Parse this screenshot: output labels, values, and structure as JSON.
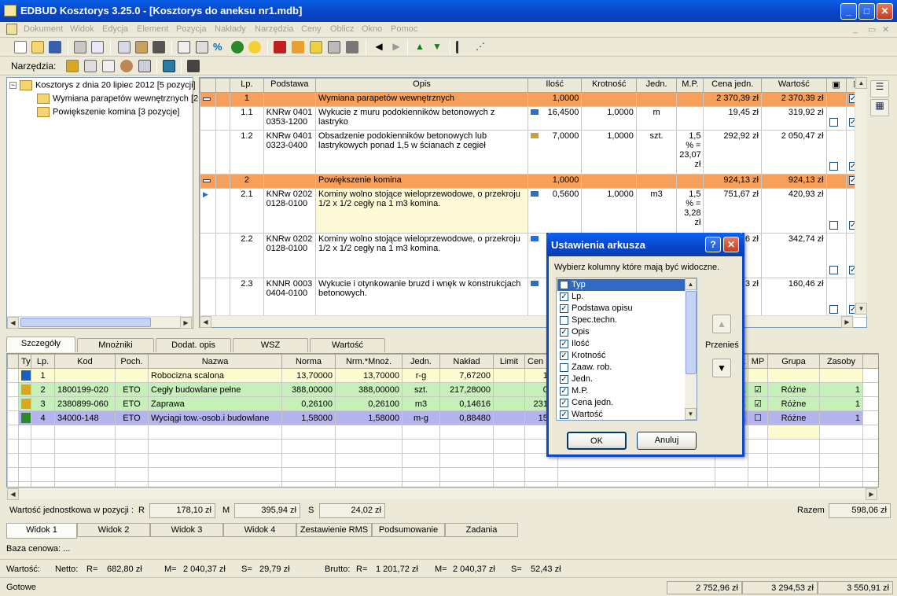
{
  "window": {
    "title": "EDBUD Kosztorys 3.25.0 - [Kosztorys do aneksu nr1.mdb]"
  },
  "menu": [
    "Dokument",
    "Widok",
    "Edycja",
    "Element",
    "Pozycja",
    "Nakłady",
    "Narzędzia",
    "Ceny",
    "Oblicz",
    "Okno",
    "Pomoc"
  ],
  "toolbar2": {
    "label": "Narzędzia:"
  },
  "tree": {
    "root": "Kosztorys z dnia 20 lipiec 2012 [5 pozycji]",
    "children": [
      "Wymiana parapetów wewnętrznych [2",
      "Powiększenie komina [3 pozycje]"
    ]
  },
  "grid": {
    "headers": [
      "Lp.",
      "Podstawa",
      "Opis",
      "Ilość",
      "Krotność",
      "Jedn.",
      "M.P.",
      "Cena jedn.",
      "Wartość"
    ],
    "rows": [
      {
        "kind": "section",
        "lp": "1",
        "podstawa": "",
        "opis": "Wymiana parapetów wewnętrznych",
        "ilosc": "1,0000",
        "krotnosc": "",
        "jedn": "",
        "mp": "",
        "cena": "2 370,39 zł",
        "wartosc": "2 370,39 zł"
      },
      {
        "kind": "item",
        "lp": "1.1",
        "podstawa": "KNRw 0401 0353-1200",
        "opis": "Wykucie z muru podokienników betonowych z lastryko",
        "ilosc": "16,4500",
        "krotnosc": "1,0000",
        "jedn": "m",
        "mp": "",
        "cena": "19,45 zł",
        "wartosc": "319,92 zł"
      },
      {
        "kind": "item",
        "lp": "1.2",
        "podstawa": "KNRw 0401 0323-0400",
        "opis": "Obsadzenie podokienników betonowych lub lastrykowych ponad 1,5 w ścianach z cegieł",
        "ilosc": "7,0000",
        "krotnosc": "1,0000",
        "jedn": "szt.",
        "mp": "1,5 % = 23,07 zł",
        "cena": "292,92 zł",
        "wartosc": "2 050,47 zł"
      },
      {
        "kind": "section",
        "lp": "2",
        "podstawa": "",
        "opis": "Powiększenie komina",
        "ilosc": "1,0000",
        "krotnosc": "",
        "jedn": "",
        "mp": "",
        "cena": "924,13 zł",
        "wartosc": "924,13 zł"
      },
      {
        "kind": "item",
        "lp": "2.1",
        "podstawa": "KNRw 0202 0128-0100",
        "opis": "Kominy wolno stojące wieloprzewodowe, o przekroju 1/2 x 1/2 cegły na 1 m3 komina.",
        "ilosc": "0,5600",
        "krotnosc": "1,0000",
        "jedn": "m3",
        "mp": "1,5 % = 3,28 zł",
        "cena": "751,67 zł",
        "wartosc": "420,93 zł"
      },
      {
        "kind": "item",
        "lp": "2.2",
        "podstawa": "KNRw 0202 0128-0100",
        "opis": "Kominy wolno stojące wieloprzewodowe, o przekroju 1/2 x 1/2 cegły na 1 m3 komina.",
        "ilosc": "",
        "krotnosc": "",
        "jedn": "",
        "mp": "",
        "cena": "6 zł",
        "wartosc": "342,74 zł"
      },
      {
        "kind": "item",
        "lp": "2.3",
        "podstawa": "KNNR 0003 0404-0100",
        "opis": "Wykucie i otynkowanie bruzd i wnęk w konstrukcjach betonowych.",
        "ilosc": "",
        "krotnosc": "",
        "jedn": "",
        "mp": "",
        "cena": "3 zł",
        "wartosc": "160,46 zł"
      }
    ]
  },
  "tabs_detail": [
    "Szczegóły",
    "Mnożniki",
    "Dodat. opis",
    "WSZ",
    "Wartość"
  ],
  "lower": {
    "headers": [
      "Typ",
      "Lp.",
      "Kod",
      "Poch.",
      "Nazwa",
      "Norma",
      "Nrm.*Mnoż.",
      "Jedn.",
      "Nakład",
      "Limit",
      "Cen",
      "nik",
      "MP",
      "Grupa",
      "Zasoby"
    ],
    "rows": [
      {
        "lp": "1",
        "kod": "",
        "poch": "",
        "nazwa": "Robocizna scalona",
        "norma": "13,70000",
        "nrm": "13,70000",
        "jedn": "r-g",
        "naklad": "7,67200",
        "limit": "",
        "cen": "13,",
        "nik": "",
        "mp": "",
        "grupa": "",
        "zasoby": ""
      },
      {
        "lp": "2",
        "kod": "1800199-020",
        "poch": "ETO",
        "nazwa": "Cegły budowlane pełne",
        "norma": "388,00000",
        "nrm": "388,00000",
        "jedn": "szt.",
        "naklad": "217,28000",
        "limit": "",
        "cen": "0,8",
        "nik": "1",
        "mp": "☑",
        "grupa": "Różne",
        "zasoby": "1"
      },
      {
        "lp": "3",
        "kod": "2380899-060",
        "poch": "ETO",
        "nazwa": "Zaprawa",
        "norma": "0,26100",
        "nrm": "0,26100",
        "jedn": "m3",
        "naklad": "0,14616",
        "limit": "",
        "cen": "231,0",
        "nik": "1",
        "mp": "☑",
        "grupa": "Różne",
        "zasoby": "1"
      },
      {
        "lp": "4",
        "kod": "34000-148",
        "poch": "ETO",
        "nazwa": "Wyciągi tow.-osob.i budowlane",
        "norma": "1,58000",
        "nrm": "1,58000",
        "jedn": "m-g",
        "naklad": "0,88480",
        "limit": "",
        "cen": "15,2",
        "nik": "1",
        "mp": "☐",
        "grupa": "Różne",
        "zasoby": "1"
      }
    ]
  },
  "summary": {
    "label": "Wartość jednostkowa w pozycji :",
    "r_label": "R",
    "r": "178,10 zł",
    "m_label": "M",
    "m": "395,94 zł",
    "s_label": "S",
    "s": "24,02 zł",
    "razem_label": "Razem",
    "razem": "598,06 zł"
  },
  "tabs_views": [
    "Widok 1",
    "Widok 2",
    "Widok 3",
    "Widok 4",
    "Zestawienie RMS",
    "Podsumowanie",
    "Zadania"
  ],
  "baza": "Baza cenowa: ...",
  "wartosc": {
    "label": "Wartość:",
    "netto": "Netto:",
    "nr": "R=",
    "nrv": "682,80 zł",
    "nm": "M=",
    "nmv": "2 040,37 zł",
    "ns": "S=",
    "nsv": "29,79 zł",
    "brutto": "Brutto:",
    "br": "R=",
    "brv": "1 201,72 zł",
    "bm": "M=",
    "bmv": "2 040,37 zł",
    "bs": "S=",
    "bsv": "52,43 zł"
  },
  "status": {
    "text": "Gotowe",
    "p1": "2 752,96 zł",
    "p2": "3 294,53 zł",
    "p3": "3 550,91 zł"
  },
  "dialog": {
    "title": "Ustawienia arkusza",
    "prompt": "Wybierz kolumny które mają być widoczne.",
    "items": [
      {
        "label": "Typ",
        "checked": false
      },
      {
        "label": "Lp.",
        "checked": true
      },
      {
        "label": "Podstawa opisu",
        "checked": true
      },
      {
        "label": "Spec.techn.",
        "checked": false
      },
      {
        "label": "Opis",
        "checked": true
      },
      {
        "label": "Ilość",
        "checked": true
      },
      {
        "label": "Krotność",
        "checked": true
      },
      {
        "label": "Zaaw. rob.",
        "checked": false
      },
      {
        "label": "Jedn.",
        "checked": true
      },
      {
        "label": "M.P.",
        "checked": true
      },
      {
        "label": "Cena jedn.",
        "checked": true
      },
      {
        "label": "Wartość",
        "checked": true
      }
    ],
    "move_label": "Przenieś",
    "ok": "OK",
    "cancel": "Anuluj"
  }
}
